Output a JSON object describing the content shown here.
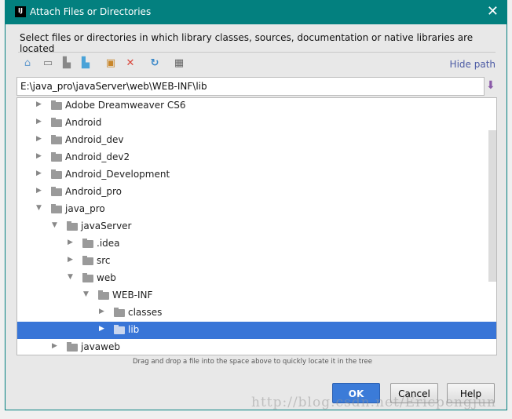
{
  "window": {
    "title": "Attach Files or Directories",
    "logo": "IJ",
    "close": "✕"
  },
  "description": "Select files or directories in which library classes, sources, documentation or native libraries are located",
  "toolbar": {
    "icons": [
      "home-icon",
      "desktop-icon",
      "project-icon",
      "module-icon",
      "new-folder-icon",
      "delete-icon",
      "refresh-icon",
      "show-hidden-icon"
    ],
    "hide_path": "Hide path"
  },
  "path": "E:\\java_pro\\javaServer\\web\\WEB-INF\\lib",
  "tree": [
    {
      "label": "Adobe Dreamweaver CS6",
      "level": 0,
      "expanded": false
    },
    {
      "label": "Android",
      "level": 0,
      "expanded": false
    },
    {
      "label": "Android_dev",
      "level": 0,
      "expanded": false
    },
    {
      "label": "Android_dev2",
      "level": 0,
      "expanded": false
    },
    {
      "label": "Android_Development",
      "level": 0,
      "expanded": false
    },
    {
      "label": "Android_pro",
      "level": 0,
      "expanded": false
    },
    {
      "label": "java_pro",
      "level": 0,
      "expanded": true
    },
    {
      "label": "javaServer",
      "level": 1,
      "expanded": true
    },
    {
      "label": ".idea",
      "level": 2,
      "expanded": false
    },
    {
      "label": "src",
      "level": 2,
      "expanded": false
    },
    {
      "label": "web",
      "level": 2,
      "expanded": true
    },
    {
      "label": "WEB-INF",
      "level": 3,
      "expanded": true
    },
    {
      "label": "classes",
      "level": 4,
      "expanded": false
    },
    {
      "label": "lib",
      "level": 4,
      "expanded": false,
      "selected": true
    },
    {
      "label": "javaweb",
      "level": 1,
      "expanded": false
    }
  ],
  "hint": "Drag and drop a file into the space above to quickly locate it in the tree",
  "buttons": {
    "ok": "OK",
    "cancel": "Cancel",
    "help": "Help"
  },
  "watermark": "http://blog.csdn.net/Ericpengjun",
  "colors": {
    "titlebar": "#03807f",
    "selection": "#3875d7",
    "link": "#4b5aa4"
  }
}
